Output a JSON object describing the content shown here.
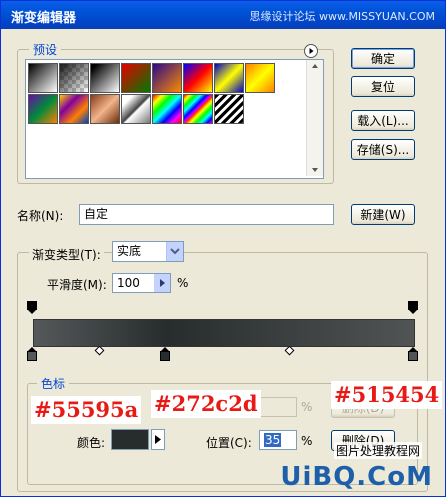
{
  "window": {
    "title": "渐变编辑器",
    "watermark": "思缘设计论坛 www.MISSYUAN.COM"
  },
  "presets": {
    "legend": "预设",
    "swatches": [
      {
        "name": "fg-bg"
      },
      {
        "name": "fg-transparent"
      },
      {
        "name": "black-white"
      },
      {
        "name": "red-green"
      },
      {
        "name": "violet-orange"
      },
      {
        "name": "blue-red-yellow"
      },
      {
        "name": "blue-yellow-blue"
      },
      {
        "name": "orange-yellow-orange"
      },
      {
        "name": "violet-green-orange"
      },
      {
        "name": "yellow-violet-orange-blue"
      },
      {
        "name": "copper"
      },
      {
        "name": "chrome"
      },
      {
        "name": "spectrum"
      },
      {
        "name": "transparent-rainbow"
      },
      {
        "name": "transparent-stripes"
      }
    ]
  },
  "buttons": {
    "ok": "确定",
    "reset": "复位",
    "load": "载入(L)...",
    "save": "存储(S)...",
    "new": "新建(W)",
    "delete_opacity": "删除(D)",
    "delete_color": "删除(D)"
  },
  "name_field": {
    "label": "名称(N):",
    "value": "自定"
  },
  "gradient_type": {
    "label": "渐变类型(T):",
    "value": "实底"
  },
  "smoothness": {
    "label": "平滑度(M):",
    "value": "100",
    "unit": "%"
  },
  "gradient": {
    "color_stops": [
      "#55595a",
      "#272c2d",
      "#515454"
    ],
    "selected_stop": 1
  },
  "stops_group": {
    "legend": "色标",
    "opacity_unit": "%",
    "color_label": "颜色:",
    "color_value": "#272c2d",
    "location_label": "位置(C):",
    "location_value": "35",
    "location_unit": "%"
  },
  "annotations": {
    "left_color": "#55595a",
    "mid_color": "#272c2d",
    "right_color": "#515454"
  },
  "overlay": {
    "site_caption": "图片处理教程网",
    "logo": "UiBQ.CoM"
  }
}
